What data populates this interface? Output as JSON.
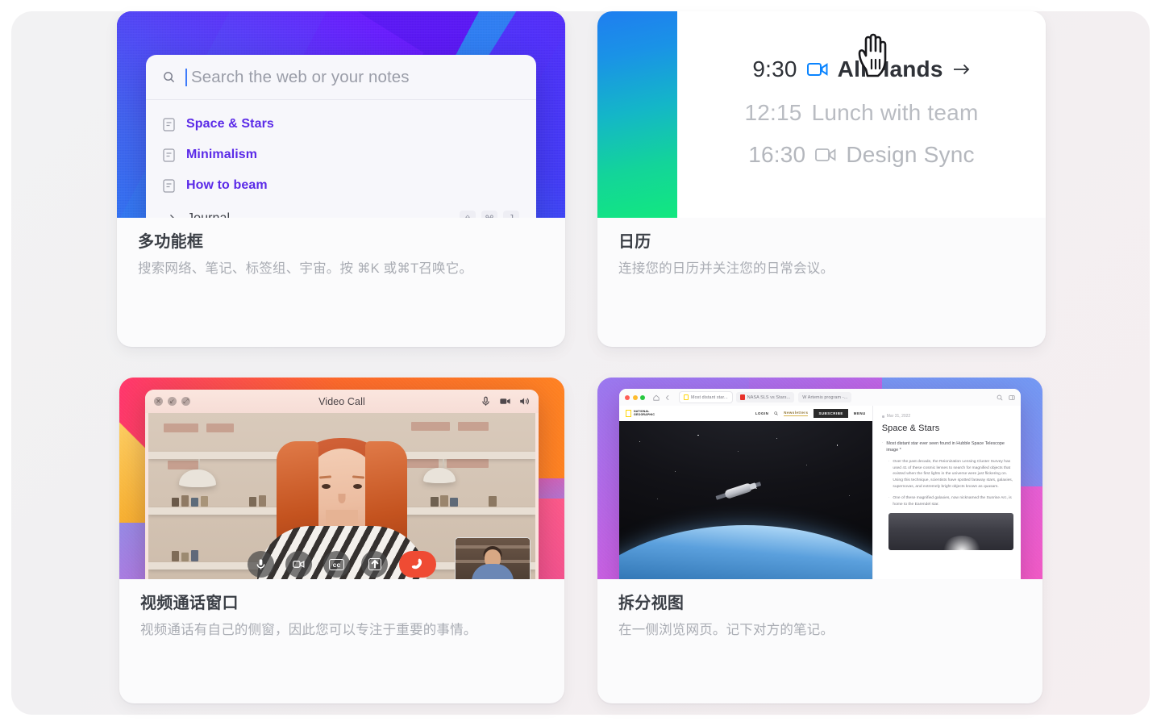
{
  "cards": {
    "omnibox": {
      "title": "多功能框",
      "description": "搜索网络、笔记、标签组、宇宙。按 ⌘K 或⌘T召唤它。",
      "search_placeholder": "Search the web or your notes",
      "results": [
        {
          "label": "Space & Stars",
          "icon": "note-icon"
        },
        {
          "label": "Minimalism",
          "icon": "note-icon"
        },
        {
          "label": "How to beam",
          "icon": "note-icon"
        }
      ],
      "action": {
        "label": "Journal",
        "icon": "arrow-right-icon",
        "shortcut": [
          "⇧",
          "⌘",
          "J"
        ]
      }
    },
    "calendar": {
      "title": "日历",
      "description": "连接您的日历并关注您的日常会议。",
      "events": [
        {
          "time": "9:30",
          "name": "All Hands",
          "icon": "video-camera-icon",
          "state": "active",
          "arrow": "→"
        },
        {
          "time": "12:15",
          "name": "Lunch with team",
          "icon": "none",
          "state": "dim"
        },
        {
          "time": "16:30",
          "name": "Design Sync",
          "icon": "video-camera-icon",
          "state": "dim"
        }
      ],
      "accent_color": "#0a84ff",
      "strip_gradient": [
        "#1f7ef0",
        "#14b6c8",
        "#12e87f"
      ]
    },
    "video": {
      "title": "视频通话窗口",
      "description": "视频通话有自己的侧窗，因此您可以专注于重要的事情。",
      "window_title": "Video Call",
      "titlebar_tools": [
        "microphone-icon",
        "video-camera-icon",
        "speaker-icon"
      ],
      "controls": [
        {
          "name": "mute-button",
          "icon": "microphone-icon"
        },
        {
          "name": "camera-button",
          "icon": "video-camera-icon"
        },
        {
          "name": "captions-button",
          "icon": "cc-icon",
          "label": "cc"
        },
        {
          "name": "share-button",
          "icon": "upload-icon"
        },
        {
          "name": "hang-up-button",
          "icon": "phone-down-icon",
          "color": "#ef4b33"
        }
      ]
    },
    "split": {
      "title": "拆分视图",
      "description": "在一侧浏览网页。记下对方的笔记。",
      "browser_tabs": [
        {
          "label": "Most distant star...",
          "favicon_color": "#ffd60a",
          "active": true
        },
        {
          "label": "NASA SLS vs Stars...",
          "favicon_color": "#e8312a",
          "active": false
        },
        {
          "label": "W  Artemis program -...",
          "favicon_color": "#ffffff",
          "active": false
        }
      ],
      "site": {
        "logo_line1": "NATIONAL",
        "logo_line2": "GEOGRAPHIC",
        "nav": [
          "LOGIN",
          "Newsletters",
          "SUBSCRIBE",
          "MENU"
        ]
      },
      "note": {
        "date": "Mar 31, 2022",
        "title": "Space & Stars",
        "bullet_main": "Most distant star ever seen found in Hubble Space Telescope image *",
        "bullet_sub_1": "Over the past decade, the Reionization Lensing Cluster Survey has used 41 of these cosmic lenses to search for magnified objects that existed when the first lights in the universe were just flickering on. Using this technique, scientists have spotted faraway stars, galaxies, supernovas, and extremely bright objects known as quasars.",
        "bullet_sub_1_bold": "Lensing Cluster",
        "bullet_sub_2": "One of these magnified galaxies, now nicknamed the Sunrise Arc, is home to the Earendel star."
      }
    }
  }
}
